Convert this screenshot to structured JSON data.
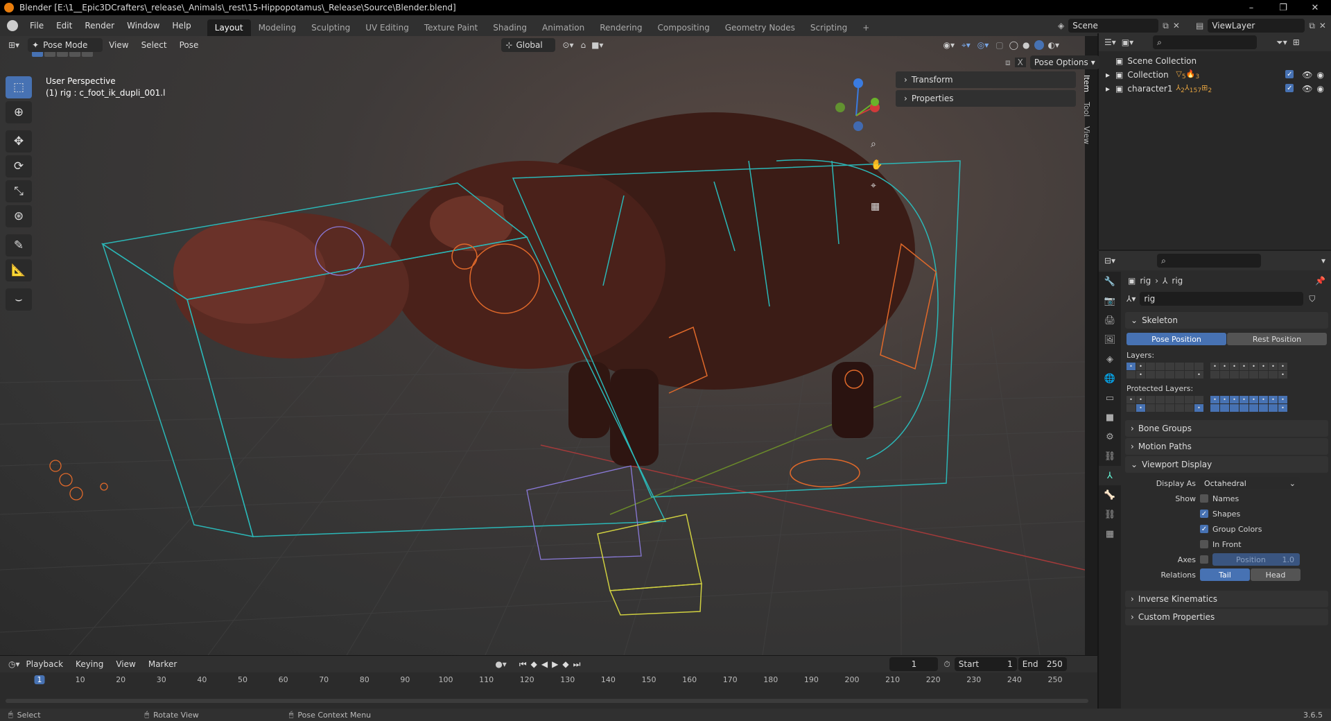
{
  "window": {
    "title": "Blender [E:\\1__Epic3DCrafters\\_release\\_Animals\\_rest\\15-Hippopotamus\\_Release\\Source\\Blender.blend]"
  },
  "menu": [
    "File",
    "Edit",
    "Render",
    "Window",
    "Help"
  ],
  "workspaces": [
    "Layout",
    "Modeling",
    "Sculpting",
    "UV Editing",
    "Texture Paint",
    "Shading",
    "Animation",
    "Rendering",
    "Compositing",
    "Geometry Nodes",
    "Scripting"
  ],
  "scene": {
    "name": "Scene",
    "view_layer": "ViewLayer"
  },
  "viewport_header": {
    "mode": "Pose Mode",
    "menus": [
      "View",
      "Select",
      "Pose"
    ],
    "orientation": "Global",
    "pose_options": "Pose Options"
  },
  "viewport": {
    "perspective": "User Perspective",
    "object_info": "(1) rig : c_foot_ik_dupli_001.l"
  },
  "npanel": {
    "items": [
      "Transform",
      "Properties"
    ],
    "tabs": [
      "Item",
      "Tool",
      "View"
    ]
  },
  "outliner": {
    "root": "Scene Collection",
    "items": [
      {
        "name": "Collection",
        "b1": "5",
        "b2": "3"
      },
      {
        "name": "character1",
        "b1": "2",
        "b2": "157",
        "b3": "2"
      }
    ]
  },
  "properties": {
    "breadcrumb": [
      "rig",
      "rig"
    ],
    "datablock": "rig",
    "skeleton": "Skeleton",
    "pose_position": "Pose Position",
    "rest_position": "Rest Position",
    "layers_label": "Layers:",
    "protected_label": "Protected Layers:",
    "bone_groups": "Bone Groups",
    "motion_paths": "Motion Paths",
    "viewport_display": "Viewport Display",
    "display_as_label": "Display As",
    "display_as": "Octahedral",
    "show_label": "Show",
    "show": [
      {
        "label": "Names",
        "checked": false
      },
      {
        "label": "Shapes",
        "checked": true
      },
      {
        "label": "Group Colors",
        "checked": true
      },
      {
        "label": "In Front",
        "checked": false
      }
    ],
    "axes_label": "Axes",
    "axes_position": "Position",
    "axes_value": "1.0",
    "relations_label": "Relations",
    "relations_tail": "Tail",
    "relations_head": "Head",
    "inverse_kinematics": "Inverse Kinematics",
    "custom_properties": "Custom Properties"
  },
  "timeline": {
    "menus": [
      "Playback",
      "Keying",
      "View",
      "Marker"
    ],
    "current_frame": "1",
    "start_label": "Start",
    "start": "1",
    "end_label": "End",
    "end": "250",
    "ticks": [
      "1",
      "10",
      "20",
      "30",
      "40",
      "50",
      "60",
      "70",
      "80",
      "90",
      "100",
      "110",
      "120",
      "130",
      "140",
      "150",
      "160",
      "170",
      "180",
      "190",
      "200",
      "210",
      "220",
      "230",
      "240",
      "250"
    ]
  },
  "status": {
    "select": "Select",
    "rotate": "Rotate View",
    "context": "Pose Context Menu",
    "version": "3.6.5"
  },
  "colors": {
    "accent": "#4772b3",
    "rig_cyan": "#2bb7b7",
    "rig_orange": "#e0692a",
    "rig_yellow": "#cfcf40"
  }
}
